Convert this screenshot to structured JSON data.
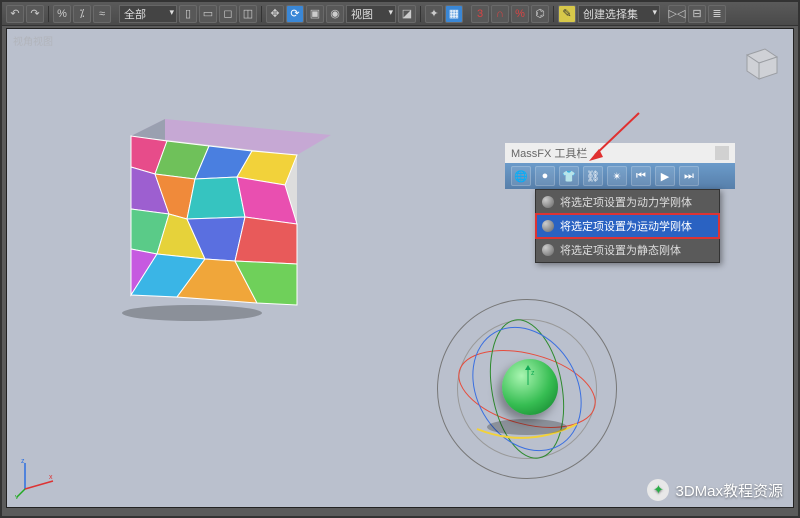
{
  "toolbar": {
    "filter_label": "全部",
    "viewport_label": "视图",
    "selection_set_label": "创建选择集"
  },
  "viewport": {
    "label": "视角视图"
  },
  "massfx": {
    "title": "MassFX 工具栏",
    "menu_items": [
      "将选定项设置为动力学刚体",
      "将选定项设置为运动学刚体",
      "将选定项设置为静态刚体"
    ]
  },
  "watermark": "3DMax教程资源"
}
